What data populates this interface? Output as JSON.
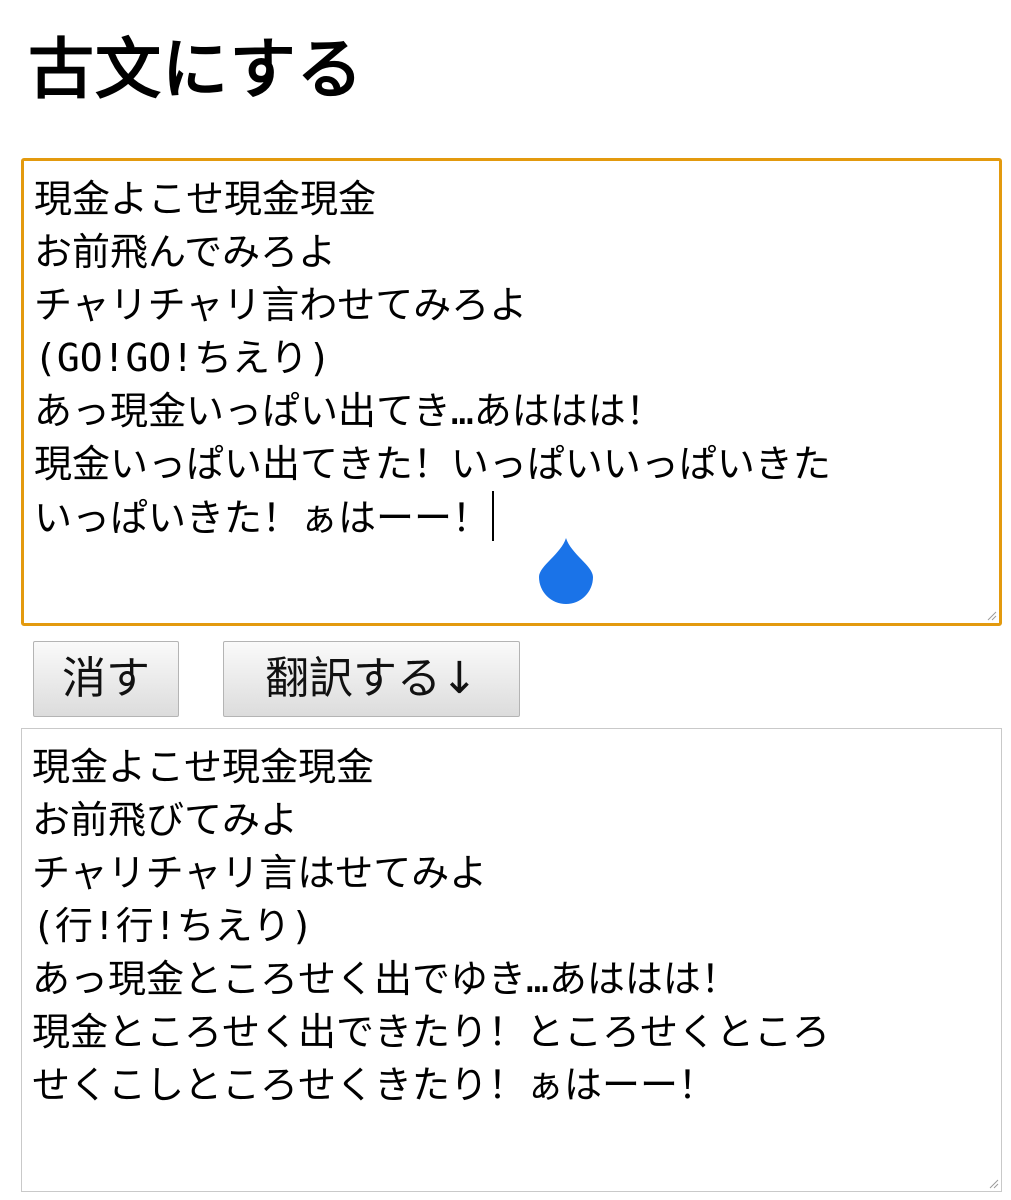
{
  "page_title": "古文にする",
  "input": {
    "lines": [
      "現金よこせ現金現金",
      "お前飛んでみろよ",
      "チャリチャリ言わせてみろよ",
      "(GO!GO!ちえり)",
      "あっ現金いっぱい出てき…あははは！",
      "現金いっぱい出てきた！いっぱいいっぱいきた",
      "いっぱいきた！ぁはーー！"
    ]
  },
  "buttons": {
    "clear_label": "消す",
    "translate_label": "翻訳する↓"
  },
  "output": {
    "lines": [
      "現金よこせ現金現金",
      "お前飛びてみよ",
      "チャリチャリ言はせてみよ",
      "(行!行!ちえり)",
      "あっ現金ところせく出でゆき…あははは！",
      "現金ところせく出できたり！ところせくところ",
      "せくこしところせくきたり！ぁはーー！"
    ]
  },
  "colors": {
    "focus_border": "#e39a0e",
    "selection_handle": "#1a73e8",
    "output_border": "#c9c9c9"
  },
  "icons": {
    "selection_handle": "text-cursor-handle-icon",
    "resize_handle": "resize-grip-icon"
  }
}
